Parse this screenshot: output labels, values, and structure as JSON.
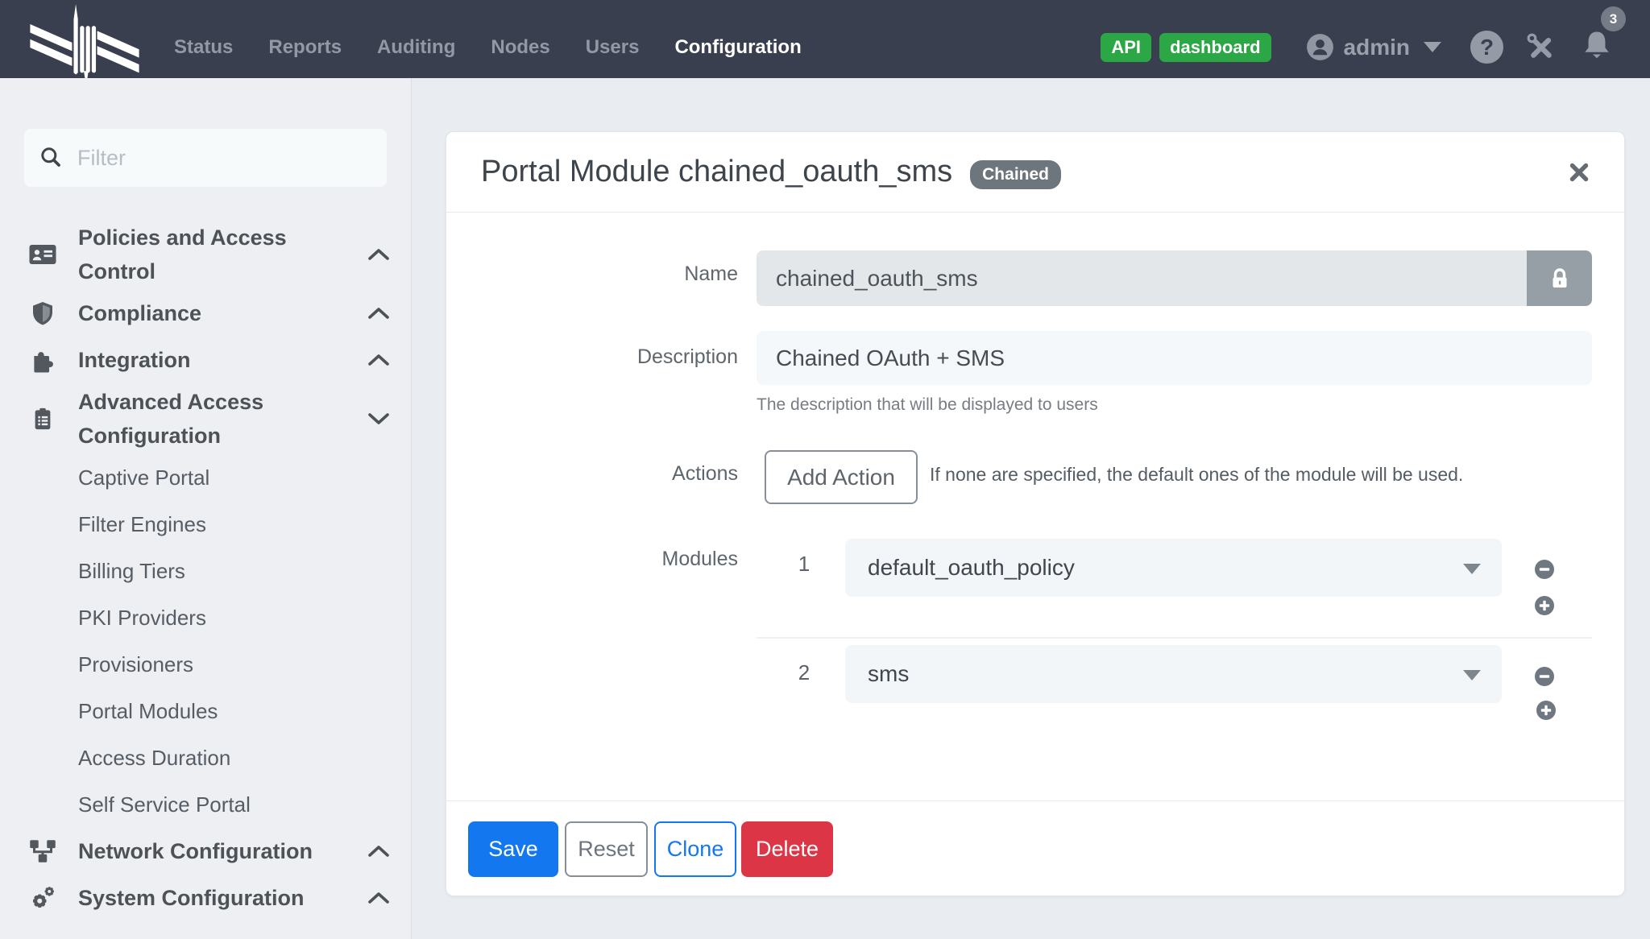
{
  "colors": {
    "navbar_bg": "#3a3f50",
    "sidebar_bg": "#edeff3",
    "accent_blue": "#1377f0",
    "success_green": "#2ca745",
    "danger_red": "#dc3545",
    "badge_gray": "#6d757d"
  },
  "icons": {
    "help_glyph": "?"
  },
  "navbar": {
    "items": [
      "Status",
      "Reports",
      "Auditing",
      "Nodes",
      "Users",
      "Configuration"
    ],
    "active_item": "Configuration",
    "badges": [
      "API",
      "dashboard"
    ],
    "user": "admin",
    "notification_count": "3"
  },
  "sidebar": {
    "filter_placeholder": "Filter",
    "sections": [
      {
        "label": "Policies and Access Control",
        "icon": "id-card-icon",
        "state": "collapsed"
      },
      {
        "label": "Compliance",
        "icon": "shield-icon",
        "state": "collapsed"
      },
      {
        "label": "Integration",
        "icon": "puzzle-icon",
        "state": "collapsed"
      },
      {
        "label": "Advanced Access Configuration",
        "icon": "clipboard-list-icon",
        "state": "expanded",
        "children": [
          "Captive Portal",
          "Filter Engines",
          "Billing Tiers",
          "PKI Providers",
          "Provisioners",
          "Portal Modules",
          "Access Duration",
          "Self Service Portal"
        ]
      },
      {
        "label": "Network Configuration",
        "icon": "network-icon",
        "state": "collapsed"
      },
      {
        "label": "System Configuration",
        "icon": "gears-icon",
        "state": "collapsed"
      }
    ]
  },
  "main": {
    "title": "Portal Module chained_oauth_sms",
    "type_badge": "Chained",
    "form": {
      "name": {
        "label": "Name",
        "value": "chained_oauth_sms"
      },
      "description": {
        "label": "Description",
        "value": "Chained OAuth + SMS",
        "help": "The description that will be displayed to users"
      },
      "actions": {
        "label": "Actions",
        "add_button": "Add Action",
        "help": "If none are specified, the default ones of the module will be used."
      },
      "modules": {
        "label": "Modules",
        "rows": [
          {
            "index": "1",
            "value": "default_oauth_policy"
          },
          {
            "index": "2",
            "value": "sms"
          }
        ]
      }
    },
    "footer": {
      "save": "Save",
      "reset": "Reset",
      "clone": "Clone",
      "delete": "Delete"
    }
  }
}
